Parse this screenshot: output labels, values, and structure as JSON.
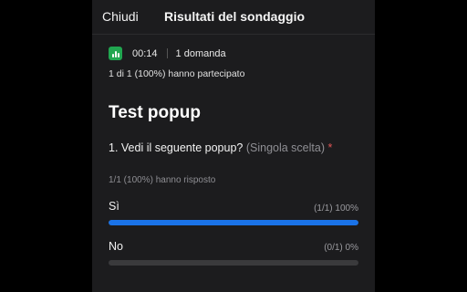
{
  "header": {
    "close_label": "Chiudi",
    "title": "Risultati del sondaggio"
  },
  "meta": {
    "icon": "poll-chart-icon",
    "icon_color": "#21a650",
    "timer": "00:14",
    "question_count": "1 domanda",
    "participation": "1 di 1 (100%) hanno partecipato"
  },
  "poll": {
    "title": "Test popup",
    "question": {
      "text": "1. Vedi il seguente popup?",
      "type": "(Singola scelta)",
      "required_mark": "*",
      "answered": "1/1 (100%) hanno risposto",
      "options": [
        {
          "label": "Sì",
          "stat": "(1/1) 100%",
          "fraction": 1.0
        },
        {
          "label": "No",
          "stat": "(0/1) 0%",
          "fraction": 0.0
        }
      ]
    }
  },
  "colors": {
    "accent": "#1a73e8",
    "track": "#3a3a3c",
    "required": "#e05555"
  }
}
